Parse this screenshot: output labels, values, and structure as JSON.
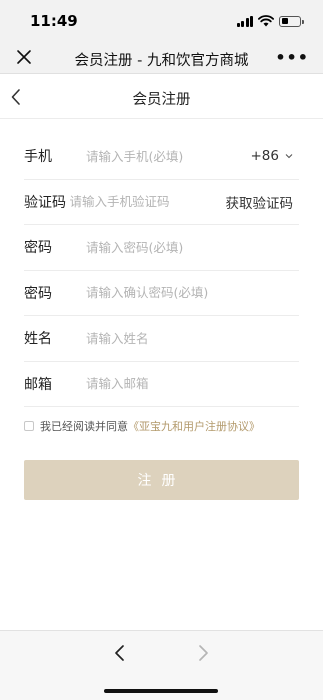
{
  "status_bar": {
    "time": "11:49"
  },
  "wechat_bar": {
    "title": "会员注册 - 九和饮官方商城"
  },
  "header": {
    "title": "会员注册"
  },
  "form": {
    "phone": {
      "label": "手机",
      "placeholder": "请输入手机(必填)",
      "country_code": "+86"
    },
    "code": {
      "label": "验证码",
      "placeholder": "请输入手机验证码",
      "action": "获取验证码"
    },
    "password": {
      "label": "密码",
      "placeholder": "请输入密码(必填)"
    },
    "confirm_password": {
      "label": "密码",
      "placeholder": "请输入确认密码(必填)"
    },
    "name": {
      "label": "姓名",
      "placeholder": "请输入姓名"
    },
    "email": {
      "label": "邮箱",
      "placeholder": "请输入邮箱"
    }
  },
  "agreement": {
    "text": "我已经阅读并同意",
    "link": "《亚宝九和用户注册协议》"
  },
  "submit_label": "注册",
  "colors": {
    "accent": "#ddd2bd",
    "link": "#b39a6c"
  }
}
